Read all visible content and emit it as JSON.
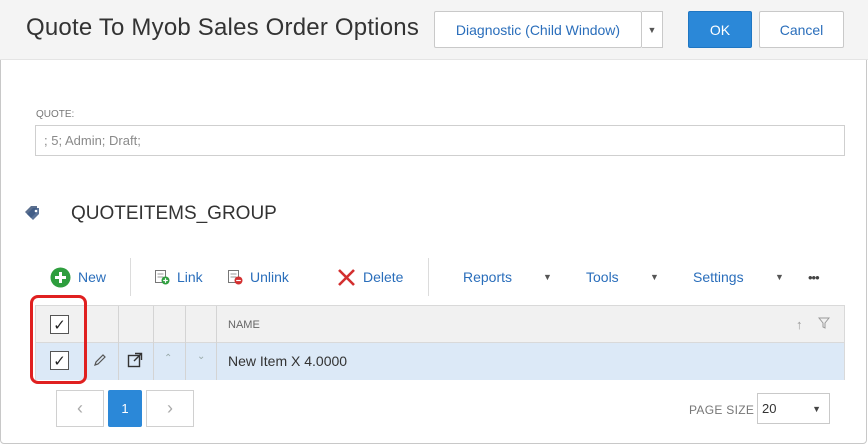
{
  "header": {
    "title": "Quote To Myob Sales Order Options",
    "diagnostic_label": "Diagnostic (Child Window)",
    "ok_label": "OK",
    "cancel_label": "Cancel"
  },
  "quote_field": {
    "label": "QUOTE:",
    "value": "; 5; Admin; Draft;"
  },
  "group": {
    "title": "QUOTEITEMS_GROUP"
  },
  "toolbar": {
    "new_label": "New",
    "link_label": "Link",
    "unlink_label": "Unlink",
    "delete_label": "Delete",
    "reports_label": "Reports",
    "tools_label": "Tools",
    "settings_label": "Settings",
    "more_label": "•••"
  },
  "grid": {
    "column_name": "NAME",
    "header_checked": true,
    "rows": [
      {
        "name": "New Item X 4.0000",
        "checked": true
      }
    ]
  },
  "pager": {
    "current_page": "1",
    "page_size_label": "PAGE SIZE",
    "page_size_value": "20"
  },
  "colors": {
    "accent": "#2b88d8",
    "link": "#2a6ebb",
    "row_selected": "#dce9f7",
    "highlight": "#e02020",
    "new_icon": "#2e9e3e",
    "delete_icon": "#d32f2f"
  }
}
